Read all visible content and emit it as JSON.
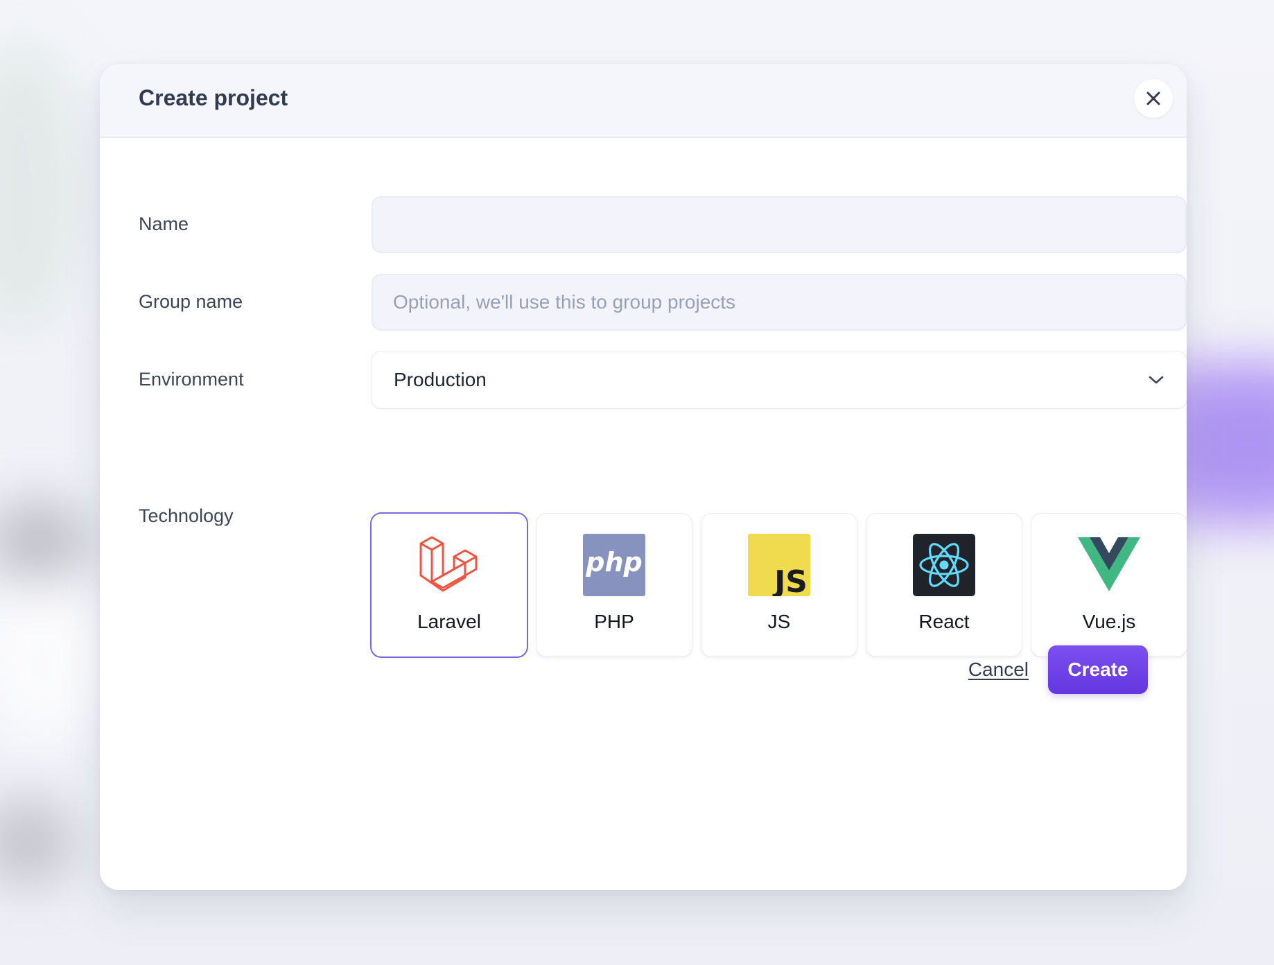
{
  "dialog": {
    "title": "Create project",
    "close_icon": "close-icon"
  },
  "form": {
    "name": {
      "label": "Name",
      "value": "",
      "placeholder": ""
    },
    "group_name": {
      "label": "Group name",
      "value": "",
      "placeholder": "Optional, we'll use this to group projects"
    },
    "environment": {
      "label": "Environment",
      "selected": "Production",
      "icon": "chevron-down-icon"
    },
    "technology": {
      "label": "Technology",
      "options": [
        {
          "name": "Laravel",
          "icon": "laravel-icon",
          "selected": true,
          "color": "#f05340"
        },
        {
          "name": "PHP",
          "icon": "php-icon",
          "selected": false,
          "color": "#8892bf"
        },
        {
          "name": "JS",
          "icon": "js-icon",
          "selected": false,
          "color": "#f0db4f"
        },
        {
          "name": "React",
          "icon": "react-icon",
          "selected": false,
          "color": "#61dafb"
        },
        {
          "name": "Vue.js",
          "icon": "vue-icon",
          "selected": false,
          "color": "#41b883"
        }
      ]
    }
  },
  "actions": {
    "cancel_label": "Cancel",
    "create_label": "Create"
  },
  "colors": {
    "accent": "#6b3fe6",
    "selected_border": "#7a67e0"
  }
}
